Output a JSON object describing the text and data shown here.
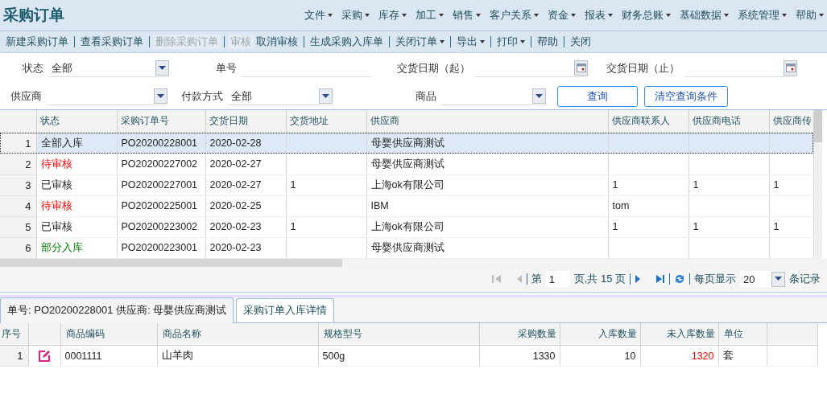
{
  "title": "采购订单",
  "menu": [
    {
      "label": "文件"
    },
    {
      "label": "采购"
    },
    {
      "label": "库存"
    },
    {
      "label": "加工"
    },
    {
      "label": "销售"
    },
    {
      "label": "客户关系"
    },
    {
      "label": "资金"
    },
    {
      "label": "报表"
    },
    {
      "label": "财务总账"
    },
    {
      "label": "基础数据"
    },
    {
      "label": "系统管理"
    },
    {
      "label": "帮助"
    }
  ],
  "toolbar": [
    {
      "label": "新建采购订单",
      "disabled": false,
      "dropdown": false
    },
    {
      "label": "查看采购订单",
      "disabled": false,
      "dropdown": false
    },
    {
      "label": "删除采购订单",
      "disabled": true,
      "dropdown": false
    },
    {
      "label": "审核",
      "disabled": true,
      "dropdown": false
    },
    {
      "label": "取消审核",
      "disabled": false,
      "dropdown": false
    },
    {
      "label": "生成采购入库单",
      "disabled": false,
      "dropdown": false
    },
    {
      "label": "关闭订单",
      "disabled": false,
      "dropdown": true
    },
    {
      "label": "导出",
      "disabled": false,
      "dropdown": true
    },
    {
      "label": "打印",
      "disabled": false,
      "dropdown": true
    },
    {
      "label": "帮助",
      "disabled": false,
      "dropdown": false
    },
    {
      "label": "关闭",
      "disabled": false,
      "dropdown": false
    }
  ],
  "filters": {
    "row_1": [
      {
        "label": "状态",
        "kind": "select",
        "value": "全部"
      },
      {
        "label": "单号",
        "kind": "text"
      },
      {
        "label": "交货日期（起）",
        "kind": "date"
      },
      {
        "label": "交货日期（止）",
        "kind": "date"
      }
    ],
    "row_2": [
      {
        "label": "供应商",
        "kind": "select"
      },
      {
        "label": "付款方式",
        "kind": "select",
        "value": "全部"
      },
      {
        "label": "商品",
        "kind": "select"
      }
    ],
    "buttons": [
      "查询",
      "清空查询条件"
    ]
  },
  "grid": {
    "columns": [
      "状态",
      "采购订单号",
      "交货日期",
      "交货地址",
      "供应商",
      "供应商联系人",
      "供应商电话",
      "供应商传"
    ],
    "rows": [
      {
        "no": "1",
        "selected": true,
        "kind": "complete",
        "cells": [
          "全部入库",
          "PO20200228001",
          "2020-02-28",
          "",
          "母婴供应商测试",
          "",
          "",
          ""
        ]
      },
      {
        "no": "2",
        "selected": false,
        "kind": "pending",
        "cells": [
          "待审核",
          "PO20200227002",
          "2020-02-27",
          "",
          "母婴供应商测试",
          "",
          "",
          ""
        ]
      },
      {
        "no": "3",
        "selected": false,
        "kind": "approved",
        "cells": [
          "已审核",
          "PO20200227001",
          "2020-02-27",
          "1",
          "上海ok有限公司",
          "1",
          "1",
          "1"
        ]
      },
      {
        "no": "4",
        "selected": false,
        "kind": "pending",
        "cells": [
          "待审核",
          "PO20200225001",
          "2020-02-25",
          "",
          "IBM",
          "tom",
          "",
          ""
        ]
      },
      {
        "no": "5",
        "selected": false,
        "kind": "approved",
        "cells": [
          "已审核",
          "PO20200223002",
          "2020-02-23",
          "1",
          "上海ok有限公司",
          "1",
          "1",
          "1"
        ]
      },
      {
        "no": "6",
        "selected": false,
        "kind": "partial",
        "cells": [
          "部分入库",
          "PO20200223001",
          "2020-02-23",
          "",
          "母婴供应商测试",
          "",
          "",
          ""
        ]
      }
    ]
  },
  "pager": {
    "page_label": "第",
    "page": "1",
    "total": "页,共 15 页",
    "per_page_label": "每页显示",
    "per_page": "20",
    "records_label": "条记录"
  },
  "tabs": [
    {
      "label": "单号: PO20200228001 供应商: 母婴供应商测试",
      "selected": true
    },
    {
      "label": "采购订单入库详情",
      "selected": false
    }
  ],
  "detail": {
    "columns": [
      "序号",
      "商品编码",
      "商品名称",
      "规格型号",
      "采购数量",
      "入库数量",
      "未入库数量",
      "单位"
    ],
    "rows": [
      {
        "no": "1",
        "code": "0001111",
        "name": "山羊肉",
        "spec": "500g",
        "ordered": "1330",
        "received": "10",
        "pending": "1320",
        "unit": "套"
      }
    ]
  }
}
